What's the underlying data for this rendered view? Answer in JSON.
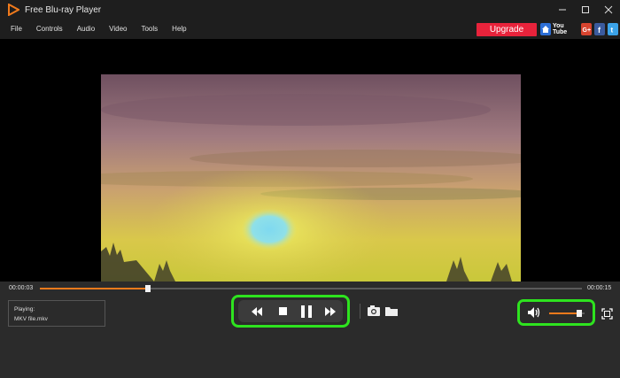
{
  "app": {
    "title": "Free Blu-ray Player"
  },
  "menu": [
    "File",
    "Controls",
    "Audio",
    "Video",
    "Tools",
    "Help"
  ],
  "upgrade_label": "Upgrade",
  "social": {
    "youtube_label": "You Tube"
  },
  "playback": {
    "current_time": "00:00:03",
    "total_time": "00:00:15",
    "progress": 0.2
  },
  "now_playing": {
    "label": "Playing:",
    "file": "MKV file.mkv"
  },
  "volume": {
    "level": 0.85
  },
  "colors": {
    "accent": "#f07a1c",
    "highlight": "#2ee31f",
    "upgrade": "#e8233b"
  },
  "icons": {
    "window": [
      "minimize-icon",
      "maximize-icon",
      "close-icon"
    ],
    "social": [
      "home-icon",
      "youtube-icon",
      "google-plus-icon",
      "facebook-icon",
      "twitter-icon"
    ],
    "controls": [
      "rewind-icon",
      "stop-icon",
      "pause-icon",
      "fast-forward-icon"
    ],
    "tools": [
      "camera-icon",
      "folder-icon"
    ],
    "volume": [
      "speaker-icon",
      "fullscreen-icon"
    ]
  }
}
